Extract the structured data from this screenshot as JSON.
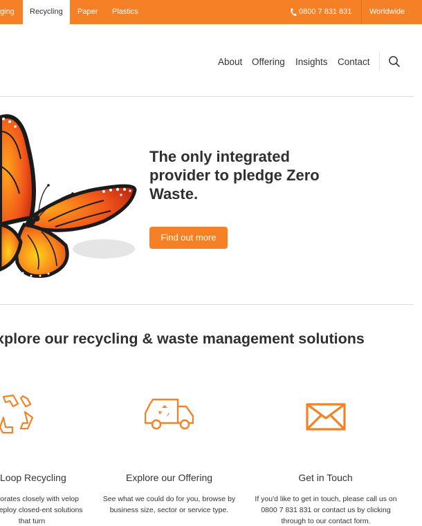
{
  "topbar": {
    "tabs": [
      {
        "label": "ging",
        "active": false
      },
      {
        "label": "Recycling",
        "active": true
      },
      {
        "label": "Paper",
        "active": false
      },
      {
        "label": "Plastics",
        "active": false
      }
    ],
    "phone": "0800 7 831 831",
    "region": "Worldwide"
  },
  "nav": {
    "items": [
      "About",
      "Offering",
      "Insights",
      "Contact"
    ]
  },
  "hero": {
    "title": "The only integrated provider to pledge Zero Waste.",
    "cta_label": "Find out more"
  },
  "solutions": {
    "title": "xplore our recycling & waste management solutions",
    "features": [
      {
        "title": "Loop Recycling",
        "description": "ollaborates closely with velop and deploy closed-ent solutions that turn",
        "icon": "recycle-icon"
      },
      {
        "title": "Explore our Offering",
        "description": "See what we could do for you, browse by business size, sector or service type.",
        "icon": "recycling-truck-icon"
      },
      {
        "title": "Get in Touch",
        "description": "If you'd like to get in touch, please call us on 0800 7 831 831 or contact us by clicking through to our contact form.",
        "icon": "envelope-icon"
      }
    ]
  },
  "colors": {
    "accent": "#f58025",
    "text": "#333333"
  }
}
